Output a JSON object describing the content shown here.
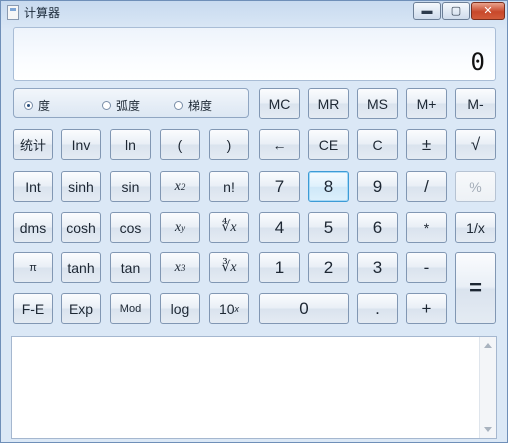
{
  "window": {
    "title": "计算器",
    "controls": {
      "minimize": "▬",
      "maximize": "▢",
      "close": "✕"
    }
  },
  "display": {
    "value": "0"
  },
  "angle_mode": {
    "options": [
      "度",
      "弧度",
      "梯度"
    ],
    "selected": "度"
  },
  "buttons": {
    "mc": "MC",
    "mr": "MR",
    "ms": "MS",
    "mplus": "M+",
    "mminus": "M-",
    "stats": "统计",
    "inv": "Inv",
    "ln": "ln",
    "lparen": "(",
    "rparen": ")",
    "backspace": "←",
    "ce": "CE",
    "c": "C",
    "plusminus": "±",
    "sqrt": "√",
    "int": "Int",
    "sinh": "sinh",
    "sin": "sin",
    "x2": "x",
    "x2_sup": "2",
    "nfact": "n!",
    "d7": "7",
    "d8": "8",
    "d9": "9",
    "divide": "/",
    "percent": "%",
    "dms": "dms",
    "cosh": "cosh",
    "cos": "cos",
    "xy": "x",
    "xy_sup": "y",
    "yroot": "∜x",
    "d4": "4",
    "d5": "5",
    "d6": "6",
    "multiply": "*",
    "reciprocal": "1/x",
    "pi": "π",
    "tanh": "tanh",
    "tan": "tan",
    "x3": "x",
    "x3_sup": "3",
    "cuberoot": "∛x",
    "d1": "1",
    "d2": "2",
    "d3": "3",
    "minus": "-",
    "equals": "=",
    "fe": "F-E",
    "exp": "Exp",
    "mod": "Mod",
    "log": "log",
    "tenx": "10",
    "tenx_sup": "x",
    "d0": "0",
    "decimal": ".",
    "plus": "+"
  },
  "icons": {
    "app": "calculator-icon",
    "scroll_up": "chevron-up-icon",
    "scroll_down": "chevron-down-icon"
  }
}
